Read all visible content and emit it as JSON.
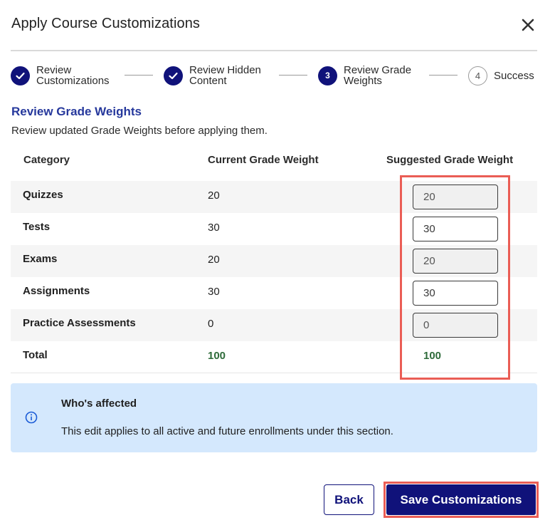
{
  "dialog": {
    "title": "Apply Course Customizations"
  },
  "stepper": {
    "steps": [
      {
        "line1": "Review",
        "line2": "Customizations",
        "state": "completed"
      },
      {
        "line1": "Review Hidden",
        "line2": "Content",
        "state": "completed"
      },
      {
        "number": "3",
        "line1": "Review Grade",
        "line2": "Weights",
        "state": "current"
      },
      {
        "number": "4",
        "line1": "Success",
        "state": "pending"
      }
    ]
  },
  "section": {
    "title": "Review Grade Weights",
    "description": "Review updated Grade Weights before applying them."
  },
  "table": {
    "headers": {
      "category": "Category",
      "current": "Current Grade Weight",
      "suggested": "Suggested Grade Weight"
    },
    "rows": [
      {
        "category": "Quizzes",
        "current": "20",
        "suggested": "20",
        "editable": false
      },
      {
        "category": "Tests",
        "current": "30",
        "suggested": "30",
        "editable": true
      },
      {
        "category": "Exams",
        "current": "20",
        "suggested": "20",
        "editable": false
      },
      {
        "category": "Assignments",
        "current": "30",
        "suggested": "30",
        "editable": true
      },
      {
        "category": "Practice Assessments",
        "current": "0",
        "suggested": "0",
        "editable": false
      }
    ],
    "total": {
      "label": "Total",
      "current": "100",
      "suggested": "100"
    }
  },
  "info": {
    "title": "Who's affected",
    "text": "This edit applies to all active and future enrollments under this section."
  },
  "footer": {
    "back_label": "Back",
    "save_label": "Save Customizations"
  },
  "colors": {
    "primary": "#10127a",
    "section_title": "#26389c",
    "total_green": "#2e6b3a",
    "info_bg": "#d4e8fd",
    "highlight": "#ea5d55"
  }
}
